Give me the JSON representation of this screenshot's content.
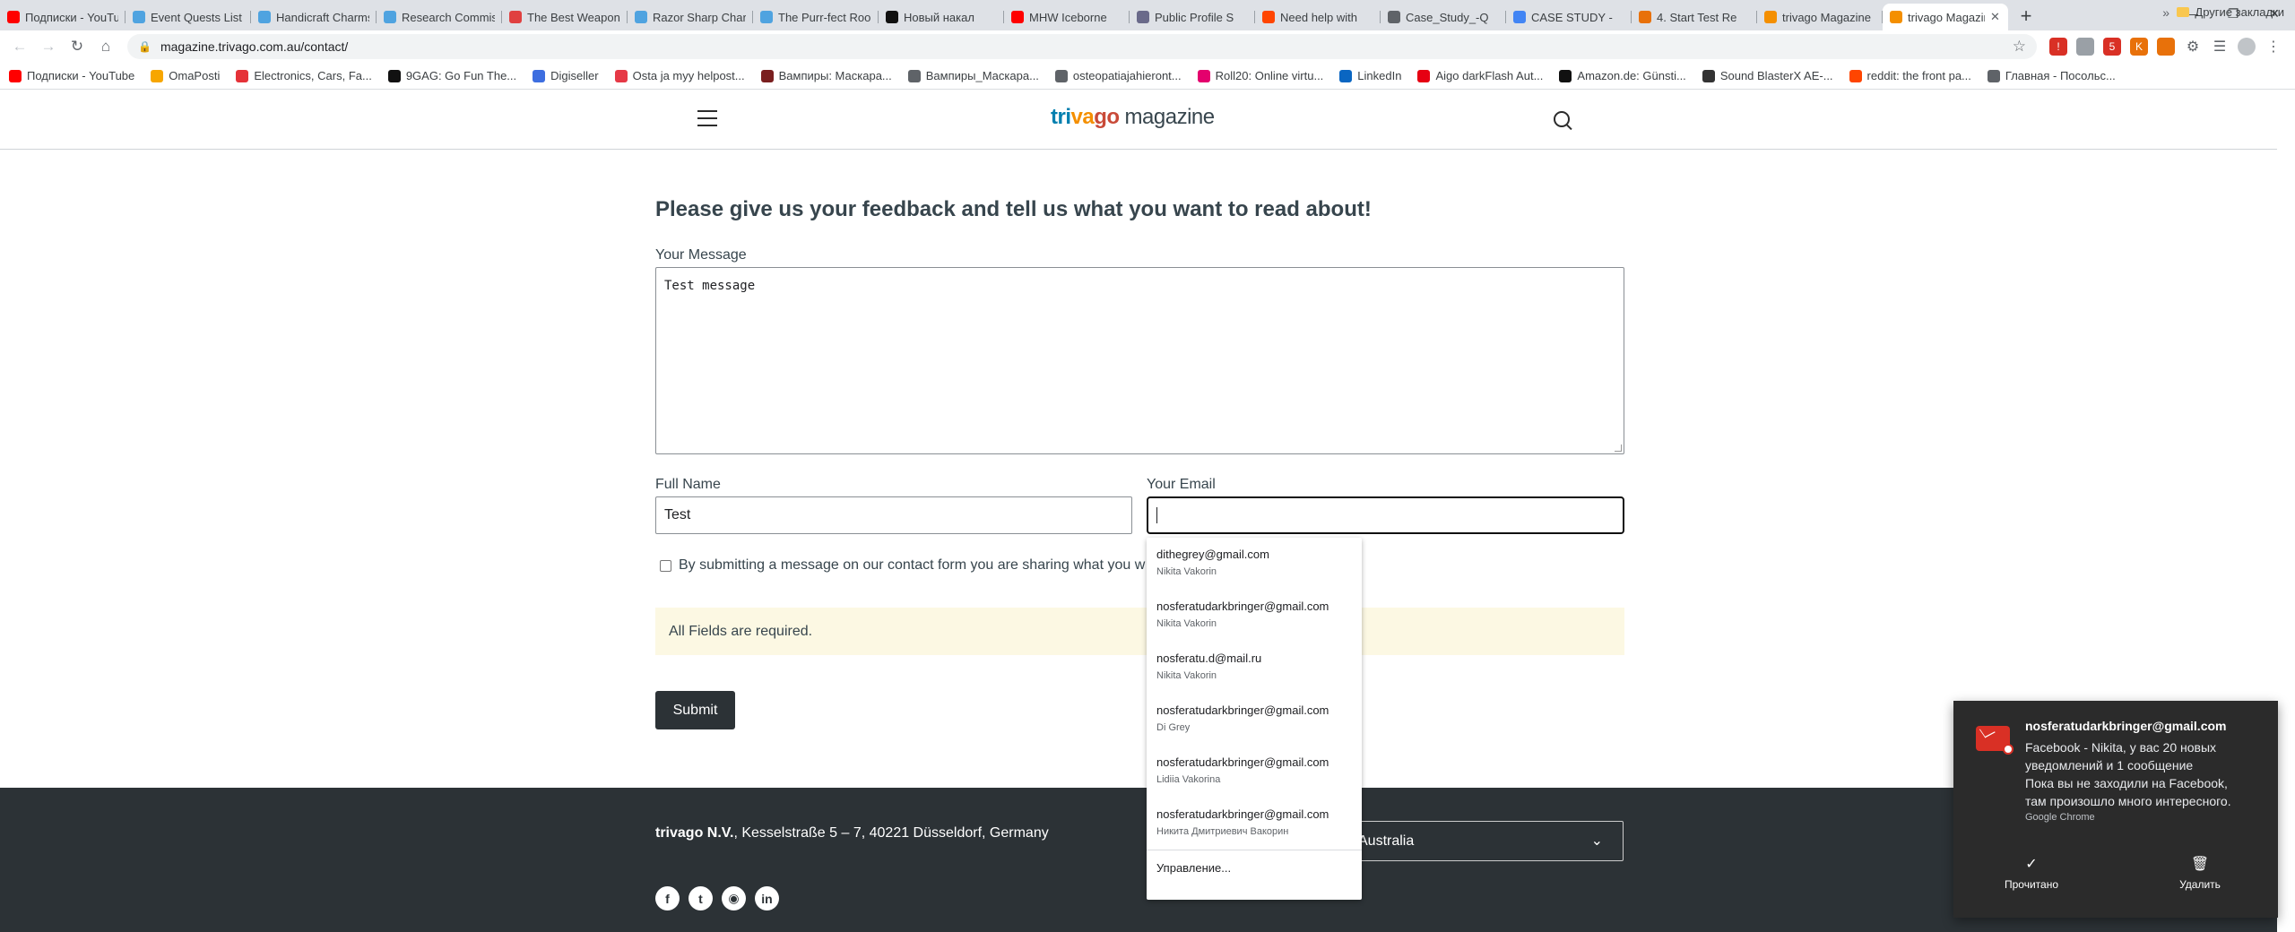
{
  "browser": {
    "tabs": [
      {
        "title": "Подписки - YouTube",
        "color": "#ff0000"
      },
      {
        "title": "Event Quests List",
        "color": "#4fa3e0"
      },
      {
        "title": "Handicraft Charms",
        "color": "#4fa3e0"
      },
      {
        "title": "Research Commission",
        "color": "#4fa3e0"
      },
      {
        "title": "The Best Weapons",
        "color": "#e04040"
      },
      {
        "title": "Razor Sharp Charm",
        "color": "#4fa3e0"
      },
      {
        "title": "The Purr-fect Room",
        "color": "#4fa3e0"
      },
      {
        "title": "Новый накал",
        "color": "#111111"
      },
      {
        "title": "MHW Iceborne",
        "color": "#ff0000"
      },
      {
        "title": "Public Profile S",
        "color": "#6a6a8a"
      },
      {
        "title": "Need help with",
        "color": "#ff4500"
      },
      {
        "title": "Case_Study_-Q",
        "color": "#5f6368"
      },
      {
        "title": "CASE STUDY -",
        "color": "#4285f4"
      },
      {
        "title": "4. Start Test Re",
        "color": "#e8710a"
      },
      {
        "title": "trivago Magazine",
        "color": "#f48f00"
      },
      {
        "title": "trivago Magazine",
        "color": "#f48f00",
        "active": true
      }
    ],
    "url": "magazine.trivago.com.au/contact/",
    "bookmarks": [
      {
        "label": "Подписки - YouTube",
        "color": "#ff0000"
      },
      {
        "label": "OmaPosti",
        "color": "#f7a600"
      },
      {
        "label": "Electronics, Cars, Fa...",
        "color": "#e53238"
      },
      {
        "label": "9GAG: Go Fun The...",
        "color": "#111111"
      },
      {
        "label": "Digiseller",
        "color": "#3d6ee0"
      },
      {
        "label": "Osta ja myy helpost...",
        "color": "#e63946"
      },
      {
        "label": "Вампиры: Маскара...",
        "color": "#7a1f1f"
      },
      {
        "label": "Вампиры_Маскара...",
        "color": "#5f6368"
      },
      {
        "label": "osteopatiajahieront...",
        "color": "#5f6368"
      },
      {
        "label": "Roll20: Online virtu...",
        "color": "#e4006d"
      },
      {
        "label": "LinkedIn",
        "color": "#0a66c2"
      },
      {
        "label": "Aigo darkFlash Aut...",
        "color": "#e60012"
      },
      {
        "label": "Amazon.de: Günsti...",
        "color": "#111111"
      },
      {
        "label": "Sound BlasterX AE-...",
        "color": "#333333"
      },
      {
        "label": "reddit: the front pa...",
        "color": "#ff4500"
      },
      {
        "label": "Главная - Посольс...",
        "color": "#5f6368"
      }
    ],
    "other_bookmarks": "Другие закладки"
  },
  "site": {
    "logo_part1": "tri",
    "logo_part2": "va",
    "logo_part3": "go",
    "logo_suffix": "magazine"
  },
  "form": {
    "title": "Please give us your feedback and tell us what you want to read about!",
    "message_label": "Your Message",
    "message_value": "Test message",
    "name_label": "Full Name",
    "name_value": "Test",
    "email_label": "Your Email",
    "email_value": "",
    "consent_text": "By submitting a message on our contact form you are sharing what you w",
    "notice": "All Fields are required.",
    "submit_label": "Submit"
  },
  "autofill": {
    "items": [
      {
        "email": "dithegrey@gmail.com",
        "name": "Nikita Vakorin"
      },
      {
        "email": "nosferatudarkbringer@gmail.com",
        "name": "Nikita Vakorin"
      },
      {
        "email": "nosferatu.d@mail.ru",
        "name": "Nikita Vakorin"
      },
      {
        "email": "nosferatudarkbringer@gmail.com",
        "name": "Di Grey"
      },
      {
        "email": "nosferatudarkbringer@gmail.com",
        "name": "Lidiia Vakorina"
      },
      {
        "email": "nosferatudarkbringer@gmail.com",
        "name": "Никита Дмитриевич Вакорин"
      }
    ],
    "manage_label": "Управление..."
  },
  "footer": {
    "company": "trivago N.V.",
    "address": ", Kesselstraße 5 – 7, 40221 Düsseldorf, Germany",
    "country": "Australia",
    "socials": [
      "facebook-icon",
      "twitter-icon",
      "instagram-icon",
      "linkedin-icon"
    ]
  },
  "notification": {
    "title": "nosferatudarkbringer@gmail.com",
    "line1": "Facebook - Nikita, у вас 20 новых",
    "line2": "уведомлений и 1 сообщение",
    "line3": "Пока вы не заходили на Facebook,",
    "line4": "там произошло много интересного.",
    "source": "Google Chrome",
    "action_read": "Прочитано",
    "action_delete": "Удалить"
  }
}
